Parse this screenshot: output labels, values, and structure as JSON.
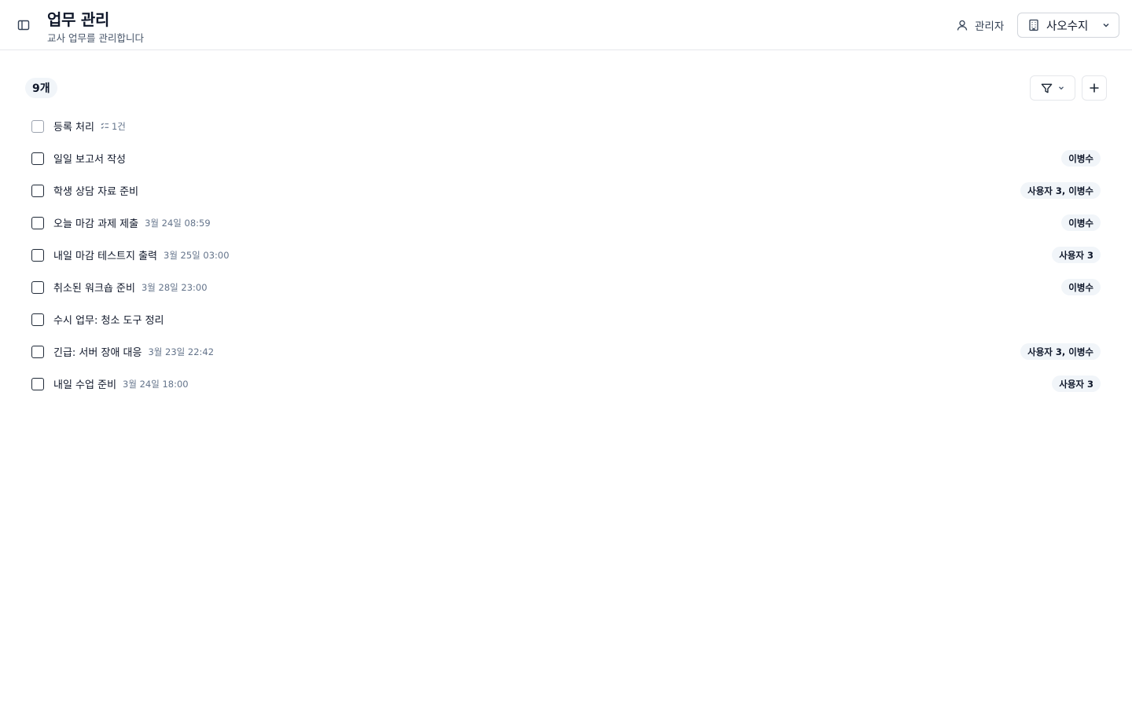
{
  "header": {
    "title": "업무 관리",
    "subtitle": "교사 업무를 관리합니다",
    "user_label": "관리자",
    "school_select": "사오수지"
  },
  "toolbar": {
    "count": "9개"
  },
  "tasks": [
    {
      "title": "등록 처리",
      "meta": "1건",
      "assignee": ""
    },
    {
      "title": "일일 보고서 작성",
      "meta": "",
      "assignee": "이병수"
    },
    {
      "title": "학생 상담 자료 준비",
      "meta": "",
      "assignee": "사용자 3, 이병수"
    },
    {
      "title": "오늘 마감 과제 제출",
      "meta": "3월 24일 08:59",
      "assignee": "이병수"
    },
    {
      "title": "내일 마감 테스트지 출력",
      "meta": "3월 25일 03:00",
      "assignee": "사용자 3"
    },
    {
      "title": "취소된 워크숍 준비",
      "meta": "3월 28일 23:00",
      "assignee": "이병수"
    },
    {
      "title": "수시 업무: 청소 도구 정리",
      "meta": "",
      "assignee": ""
    },
    {
      "title": "긴급: 서버 장애 대응",
      "meta": "3월 23일 22:42",
      "assignee": "사용자 3, 이병수"
    },
    {
      "title": "내일 수업 준비",
      "meta": "3월 24일 18:00",
      "assignee": "사용자 3"
    }
  ],
  "icons": {
    "sidebar": "sidebar-toggle-icon",
    "user": "user-icon",
    "school": "building-icon",
    "chevron": "chevron-down-icon",
    "filter": "filter-icon",
    "add": "plus-icon",
    "checklist": "list-checks-icon"
  }
}
